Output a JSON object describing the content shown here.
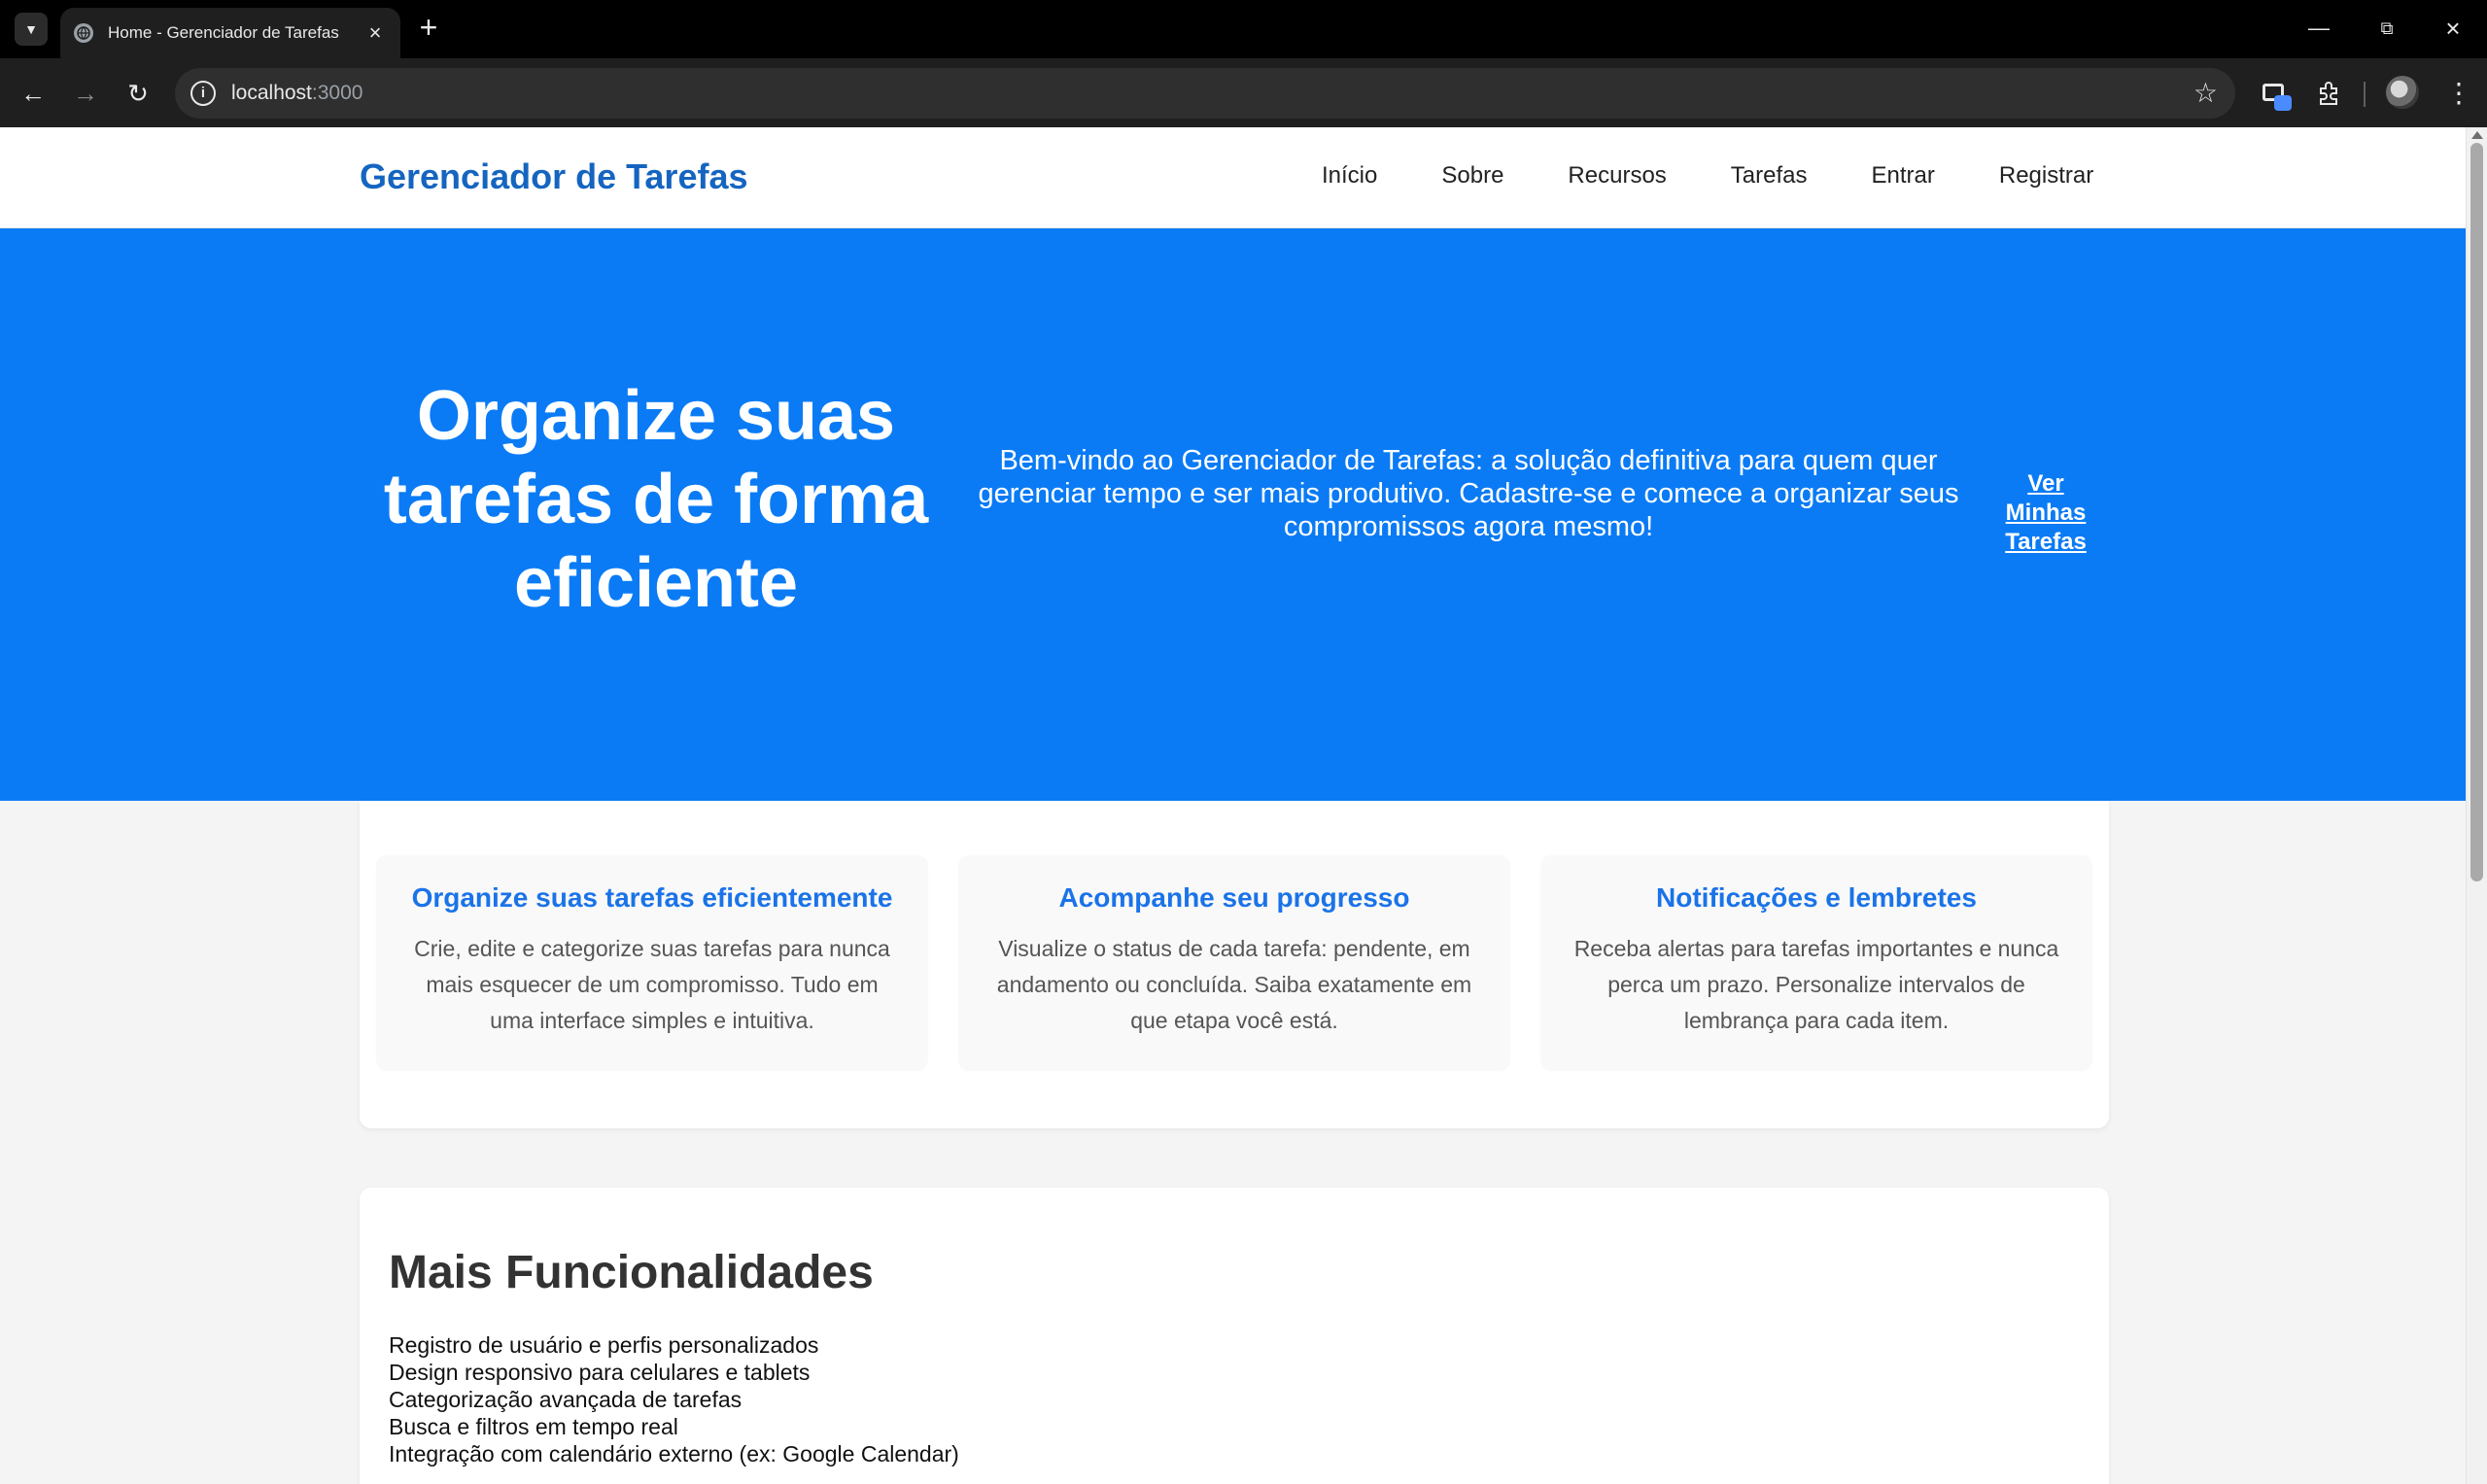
{
  "browser": {
    "tab_title": "Home - Gerenciador de Tarefas",
    "url_host": "localhost",
    "url_port": ":3000"
  },
  "header": {
    "brand": "Gerenciador de Tarefas",
    "nav": [
      "Início",
      "Sobre",
      "Recursos",
      "Tarefas",
      "Entrar",
      "Registrar"
    ]
  },
  "hero": {
    "title": "Organize suas tarefas de forma eficiente",
    "text": "Bem-vindo ao Gerenciador de Tarefas: a solução definitiva para quem quer gerenciar tempo e ser mais produtivo. Cadastre-se e comece a organizar seus compromissos agora mesmo!",
    "button": "Ver Minhas Tarefas"
  },
  "features": [
    {
      "title": "Organize suas tarefas eficientemente",
      "text": "Crie, edite e categorize suas tarefas para nunca mais esquecer de um compromisso. Tudo em uma interface simples e intuitiva."
    },
    {
      "title": "Acompanhe seu progresso",
      "text": "Visualize o status de cada tarefa: pendente, em andamento ou concluída. Saiba exatamente em que etapa você está."
    },
    {
      "title": "Notificações e lembretes",
      "text": "Receba alertas para tarefas importantes e nunca perca um prazo. Personalize intervalos de lembrança para cada item."
    }
  ],
  "more": {
    "title": "Mais Funcionalidades",
    "items": [
      "Registro de usuário e perfis personalizados",
      "Design responsivo para celulares e tablets",
      "Categorização avançada de tarefas",
      "Busca e filtros em tempo real",
      "Integração com calendário externo (ex: Google Calendar)"
    ]
  },
  "colors": {
    "brand": "#1565c0",
    "hero_background": "#0a7bf5",
    "feature_title": "#1a73e8"
  }
}
